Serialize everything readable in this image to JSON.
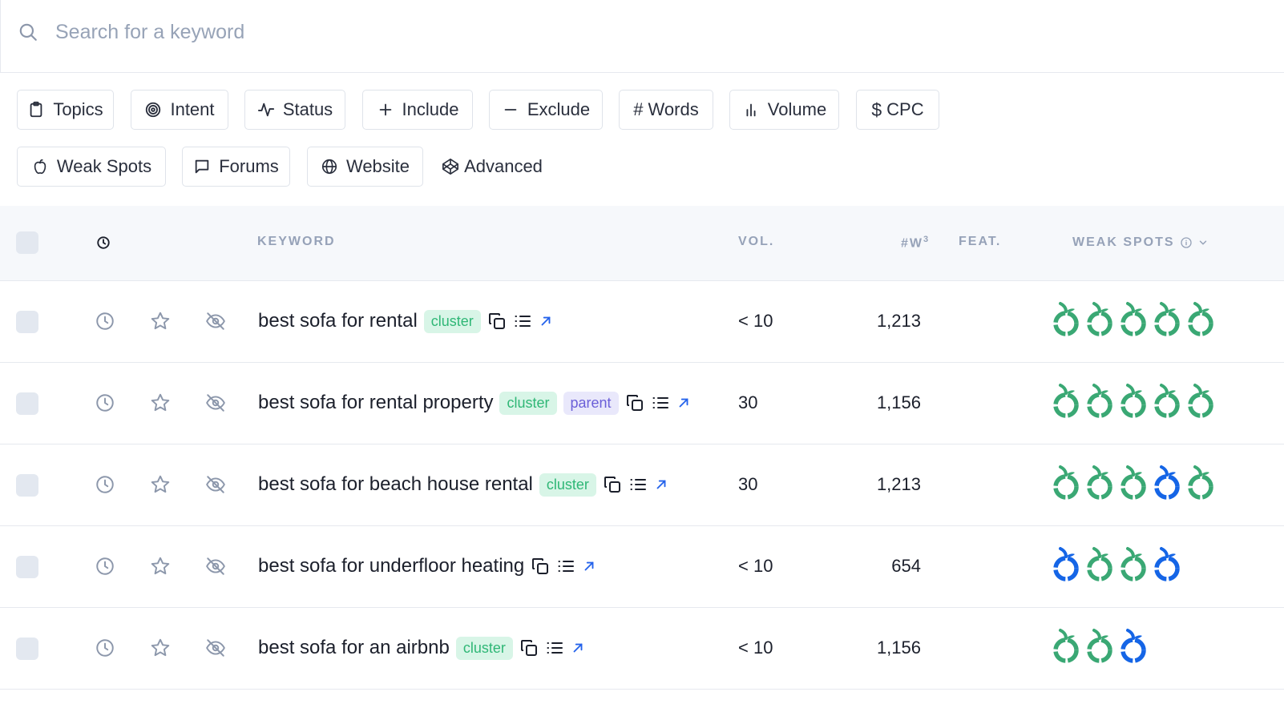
{
  "search": {
    "placeholder": "Search for a keyword"
  },
  "filters": [
    {
      "label": "Topics",
      "icon": "clipboard-icon"
    },
    {
      "label": "Intent",
      "icon": "target-icon"
    },
    {
      "label": "Status",
      "icon": "activity-icon"
    },
    {
      "label": "Include",
      "icon": "plus-icon"
    },
    {
      "label": "Exclude",
      "icon": "minus-icon"
    },
    {
      "label": "Words",
      "icon": "hash-icon"
    },
    {
      "label": "Volume",
      "icon": "bar-chart-icon"
    },
    {
      "label": "CPC",
      "icon": "dollar-icon"
    },
    {
      "label": "Weak Spots",
      "icon": "apple-icon"
    },
    {
      "label": "Forums",
      "icon": "message-square-icon"
    },
    {
      "label": "Website",
      "icon": "globe-icon"
    },
    {
      "label": "Advanced",
      "icon": "codepen-icon"
    }
  ],
  "table": {
    "headers": {
      "keyword": "KEYWORD",
      "vol": "VOL.",
      "words": "#W",
      "words_sup": "3",
      "feat": "FEAT.",
      "weak_spots": "WEAK SPOTS"
    },
    "rows": [
      {
        "keyword": "best sofa for rental",
        "tags": [
          "cluster"
        ],
        "vol": "< 10",
        "words": "1,213",
        "weak_spots": [
          "green",
          "green",
          "green",
          "green",
          "green"
        ]
      },
      {
        "keyword": "best sofa for rental property",
        "tags": [
          "cluster",
          "parent"
        ],
        "vol": "30",
        "words": "1,156",
        "weak_spots": [
          "green",
          "green",
          "green",
          "green",
          "green"
        ]
      },
      {
        "keyword": "best sofa for beach house rental",
        "tags": [
          "cluster"
        ],
        "vol": "30",
        "words": "1,213",
        "weak_spots": [
          "green",
          "green",
          "green",
          "blue",
          "green"
        ]
      },
      {
        "keyword": "best sofa for underfloor heating",
        "tags": [],
        "vol": "< 10",
        "words": "654",
        "weak_spots": [
          "blue",
          "green",
          "green",
          "blue"
        ]
      },
      {
        "keyword": "best sofa for an airbnb",
        "tags": [
          "cluster"
        ],
        "vol": "< 10",
        "words": "1,156",
        "weak_spots": [
          "green",
          "green",
          "blue"
        ]
      }
    ]
  },
  "colors": {
    "weak_green": "#3aa874",
    "weak_blue": "#1565e6",
    "cluster_bg": "#d8f5e7",
    "cluster_text": "#2fb776",
    "parent_bg": "#e9e8fb",
    "parent_text": "#6b5fd8",
    "link_blue": "#2563eb"
  }
}
